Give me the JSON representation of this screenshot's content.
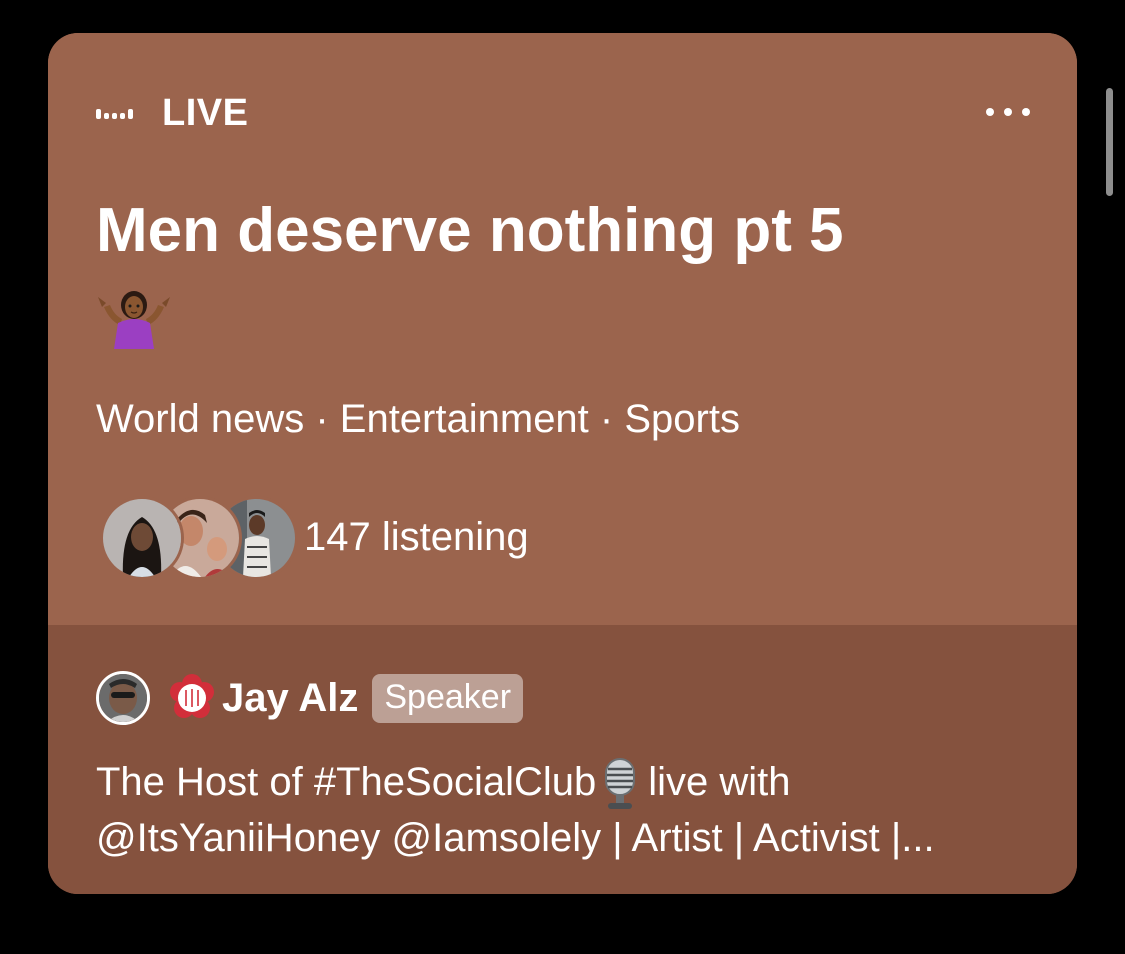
{
  "live": {
    "label": "LIVE",
    "icon": "broadcast-dots-icon"
  },
  "menu": {
    "icon": "more-horizontal-icon"
  },
  "space": {
    "title": "Men deserve nothing pt 5",
    "title_emoji": "person-shrugging-emoji",
    "topics": "World news · Entertainment · Sports",
    "listener_count_text": "147 listening",
    "listener_count": 147
  },
  "host": {
    "name": "Jay Alz",
    "role_badge": "Speaker",
    "bio_line1_before": "The Host of #TheSocialClub",
    "bio_line1_after": "live with",
    "bio_line2": "@ItsYaniiHoney @Iamsolely | Artist | Activist |..."
  },
  "colors": {
    "card_top": "#9b644d",
    "card_bottom": "#85523e",
    "background": "#000000",
    "text": "#ffffff"
  }
}
